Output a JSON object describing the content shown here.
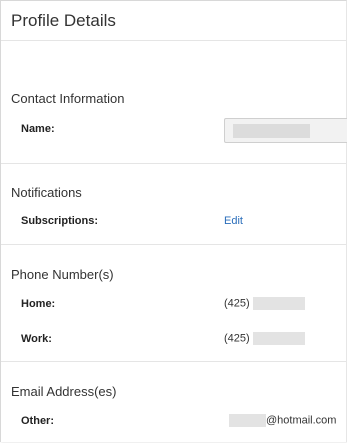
{
  "header": {
    "title": "Profile Details"
  },
  "contact": {
    "section_title": "Contact Information",
    "name_label": "Name:",
    "name_value": ""
  },
  "notifications": {
    "section_title": "Notifications",
    "subscriptions_label": "Subscriptions:",
    "edit_label": "Edit"
  },
  "phones": {
    "section_title": "Phone Number(s)",
    "home_label": "Home:",
    "home_prefix": "(425)",
    "work_label": "Work:",
    "work_prefix": "(425)"
  },
  "emails": {
    "section_title": "Email Address(es)",
    "other_label": "Other:",
    "other_domain": "@hotmail.com"
  },
  "colors": {
    "link": "#2a6ebb",
    "divider": "#e5e5e5",
    "text": "#333333"
  }
}
